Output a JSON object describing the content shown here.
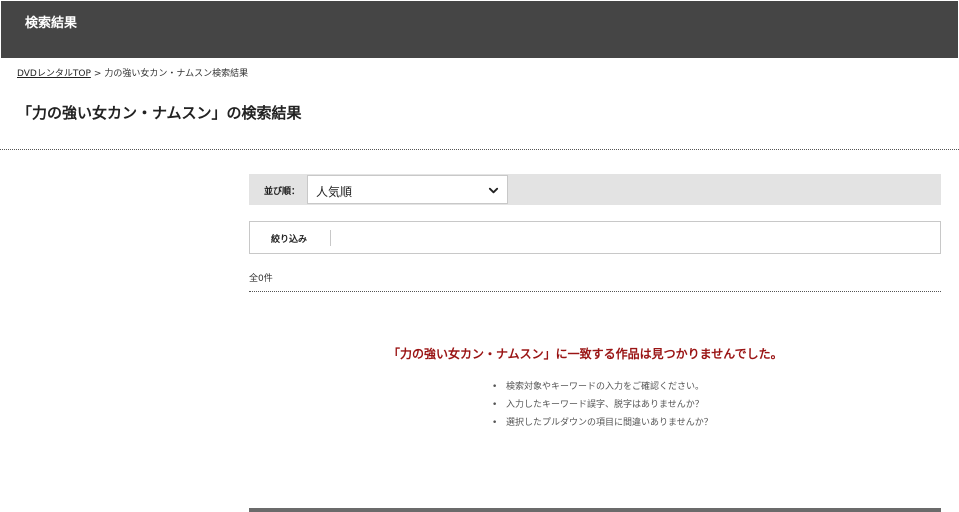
{
  "header": {
    "title": "検索結果"
  },
  "breadcrumb": {
    "home_link": "DVDレンタルTOP",
    "separator": ">",
    "current": "力の強い女カン・ナムスン検索結果"
  },
  "page_title": "「力の強い女カン・ナムスン」の検索結果",
  "sort": {
    "label": "並び順：",
    "selected": "人気順"
  },
  "filter": {
    "label": "絞り込み"
  },
  "result_count": "全0件",
  "no_result": {
    "message": "「力の強い女カン・ナムスン」に一致する作品は見つかりませんでした。",
    "tips": [
      "検索対象やキーワードの入力をご確認ください。",
      "入力したキーワード誤字、脱字はありませんか？",
      "選択したプルダウンの項目に間違いありませんか？"
    ]
  },
  "colors": {
    "header_bg": "#454545",
    "sort_bar_bg": "#e3e3e3",
    "no_result_text": "#9a1414"
  }
}
